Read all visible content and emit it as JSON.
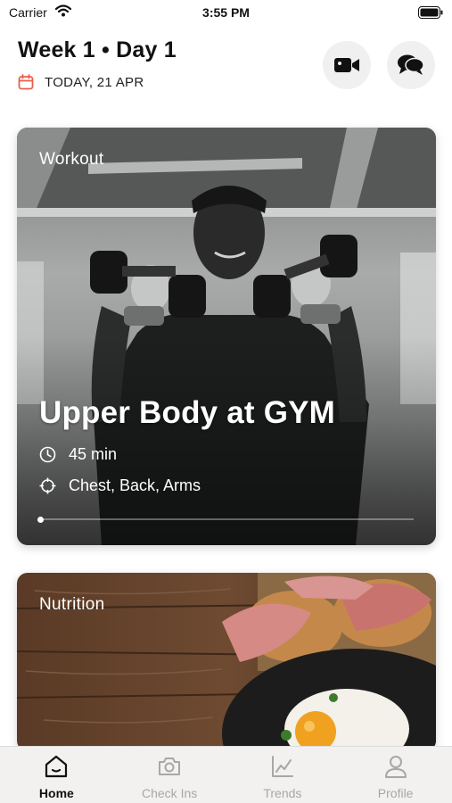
{
  "status_bar": {
    "carrier": "Carrier",
    "time": "3:55 PM"
  },
  "header": {
    "title": "Week 1 • Day 1",
    "date": "TODAY, 21 APR",
    "accent_color": "#e8614a"
  },
  "workout_card": {
    "tag": "Workout",
    "title": "Upper Body at GYM",
    "duration": "45 min",
    "focus": "Chest, Back, Arms",
    "progress": 0
  },
  "nutrition_card": {
    "tag": "Nutrition"
  },
  "tab_bar": {
    "items": [
      {
        "label": "Home",
        "icon": "home-icon",
        "active": true
      },
      {
        "label": "Check Ins",
        "icon": "camera-icon",
        "active": false
      },
      {
        "label": "Trends",
        "icon": "chart-icon",
        "active": false
      },
      {
        "label": "Profile",
        "icon": "person-icon",
        "active": false
      }
    ]
  }
}
